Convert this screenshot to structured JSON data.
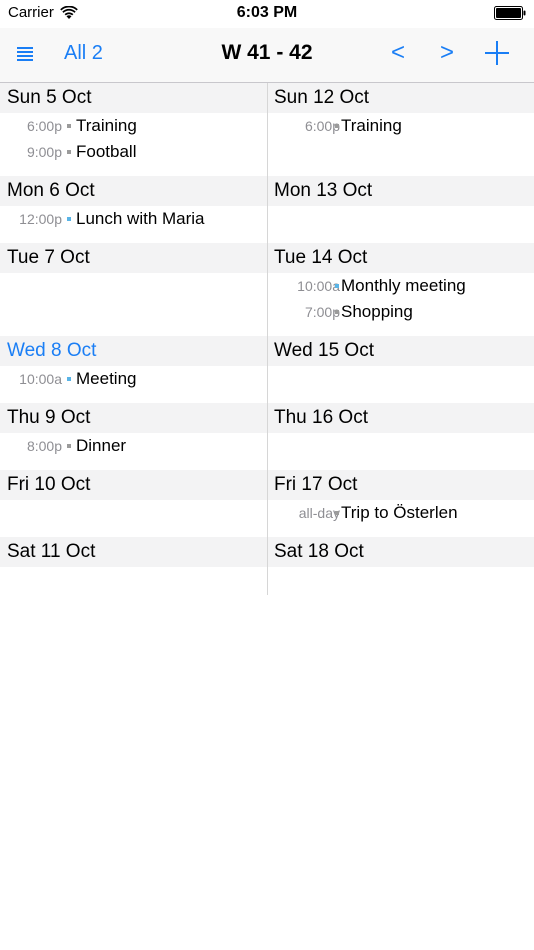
{
  "status_bar": {
    "carrier": "Carrier",
    "time": "6:03 PM"
  },
  "nav": {
    "calendars_label": "All 2",
    "title": "W 41 - 42",
    "prev_label": "<",
    "next_label": ">",
    "accent_color": "#1a7ef5"
  },
  "icons": {
    "menu": "list-icon",
    "add": "plus-icon",
    "wifi": "wifi-icon",
    "battery": "battery-icon"
  },
  "colors": {
    "accent": "#1a7ef5",
    "calendar_gray": "#9b9b9b",
    "calendar_blue": "#5ab4e6",
    "header_bg": "#f3f3f4"
  },
  "week_left": {
    "days": [
      {
        "label": "Sun 5 Oct",
        "events": [
          {
            "time": "6:00p",
            "title": "Training",
            "calendar": "gray"
          },
          {
            "time": "9:00p",
            "title": "Football",
            "calendar": "gray"
          }
        ]
      },
      {
        "label": "Mon 6 Oct",
        "events": [
          {
            "time": "12:00p",
            "title": "Lunch with Maria",
            "calendar": "blue"
          }
        ]
      },
      {
        "label": "Tue 7 Oct",
        "events": []
      },
      {
        "label": "Wed 8 Oct",
        "today": true,
        "events": [
          {
            "time": "10:00a",
            "title": "Meeting",
            "calendar": "blue"
          }
        ]
      },
      {
        "label": "Thu 9 Oct",
        "events": [
          {
            "time": "8:00p",
            "title": "Dinner",
            "calendar": "gray"
          }
        ]
      },
      {
        "label": "Fri 10 Oct",
        "events": []
      },
      {
        "label": "Sat 11 Oct",
        "events": []
      }
    ]
  },
  "week_right": {
    "days": [
      {
        "label": "Sun 12 Oct",
        "events": [
          {
            "time": "6:00p",
            "title": "Training",
            "calendar": "gray"
          }
        ]
      },
      {
        "label": "Mon 13 Oct",
        "events": []
      },
      {
        "label": "Tue 14 Oct",
        "events": [
          {
            "time": "10:00a",
            "title": "Monthly meeting",
            "calendar": "blue"
          },
          {
            "time": "7:00p",
            "title": "Shopping",
            "calendar": "gray"
          }
        ]
      },
      {
        "label": "Wed 15 Oct",
        "events": []
      },
      {
        "label": "Thu 16 Oct",
        "events": []
      },
      {
        "label": "Fri 17 Oct",
        "events": [
          {
            "time": "all-day",
            "title": "Trip to Österlen",
            "calendar": "gray"
          }
        ]
      },
      {
        "label": "Sat 18 Oct",
        "events": []
      }
    ]
  }
}
